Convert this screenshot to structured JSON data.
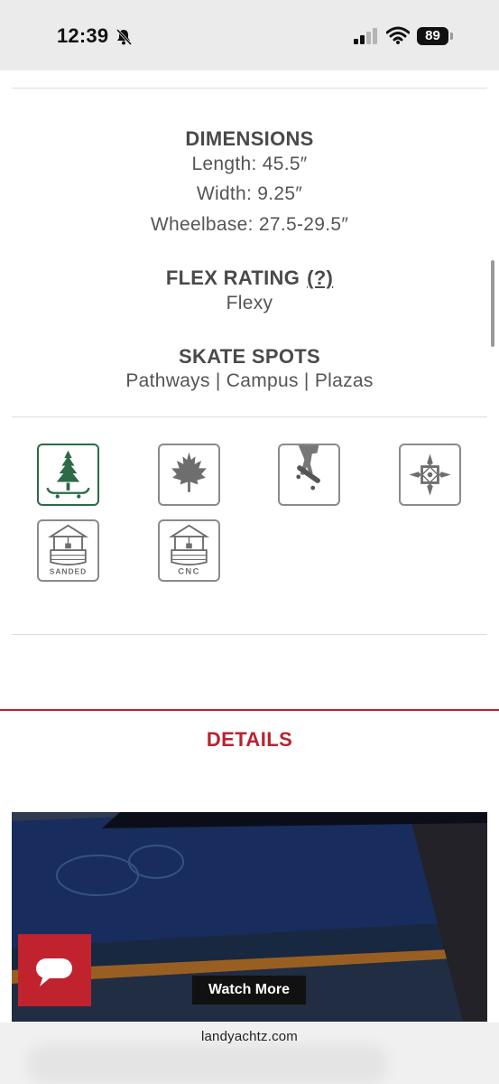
{
  "status_bar": {
    "time": "12:39",
    "battery": "89"
  },
  "specs": {
    "dimensions": {
      "heading": "DIMENSIONS",
      "length": "Length: 45.5″",
      "width": "Width: 9.25″",
      "wheelbase": "Wheelbase: 27.5-29.5″"
    },
    "flex": {
      "heading": "FLEX RATING",
      "help_link": "(?)",
      "value": "Flexy"
    },
    "skate_spots": {
      "heading": "SKATE SPOTS",
      "value": "Pathways | Campus | Plazas"
    }
  },
  "feature_icons": [
    {
      "name": "tree-on-board-icon",
      "active": true
    },
    {
      "name": "maple-leaf-icon",
      "active": false
    },
    {
      "name": "skater-icon",
      "active": false
    },
    {
      "name": "compass-ornament-icon",
      "active": false
    },
    {
      "name": "wishing-well-sanded-icon",
      "label": "SANDED",
      "active": false
    },
    {
      "name": "wishing-well-cnc-icon",
      "label": "CNC",
      "active": false
    }
  ],
  "details": {
    "heading": "DETAILS",
    "watch_more": "Watch More"
  },
  "browser": {
    "url": "landyachtz.com"
  },
  "colors": {
    "accent_red": "#b8232f",
    "active_green": "#2d6a47",
    "text_gray": "#4a4a4a"
  }
}
